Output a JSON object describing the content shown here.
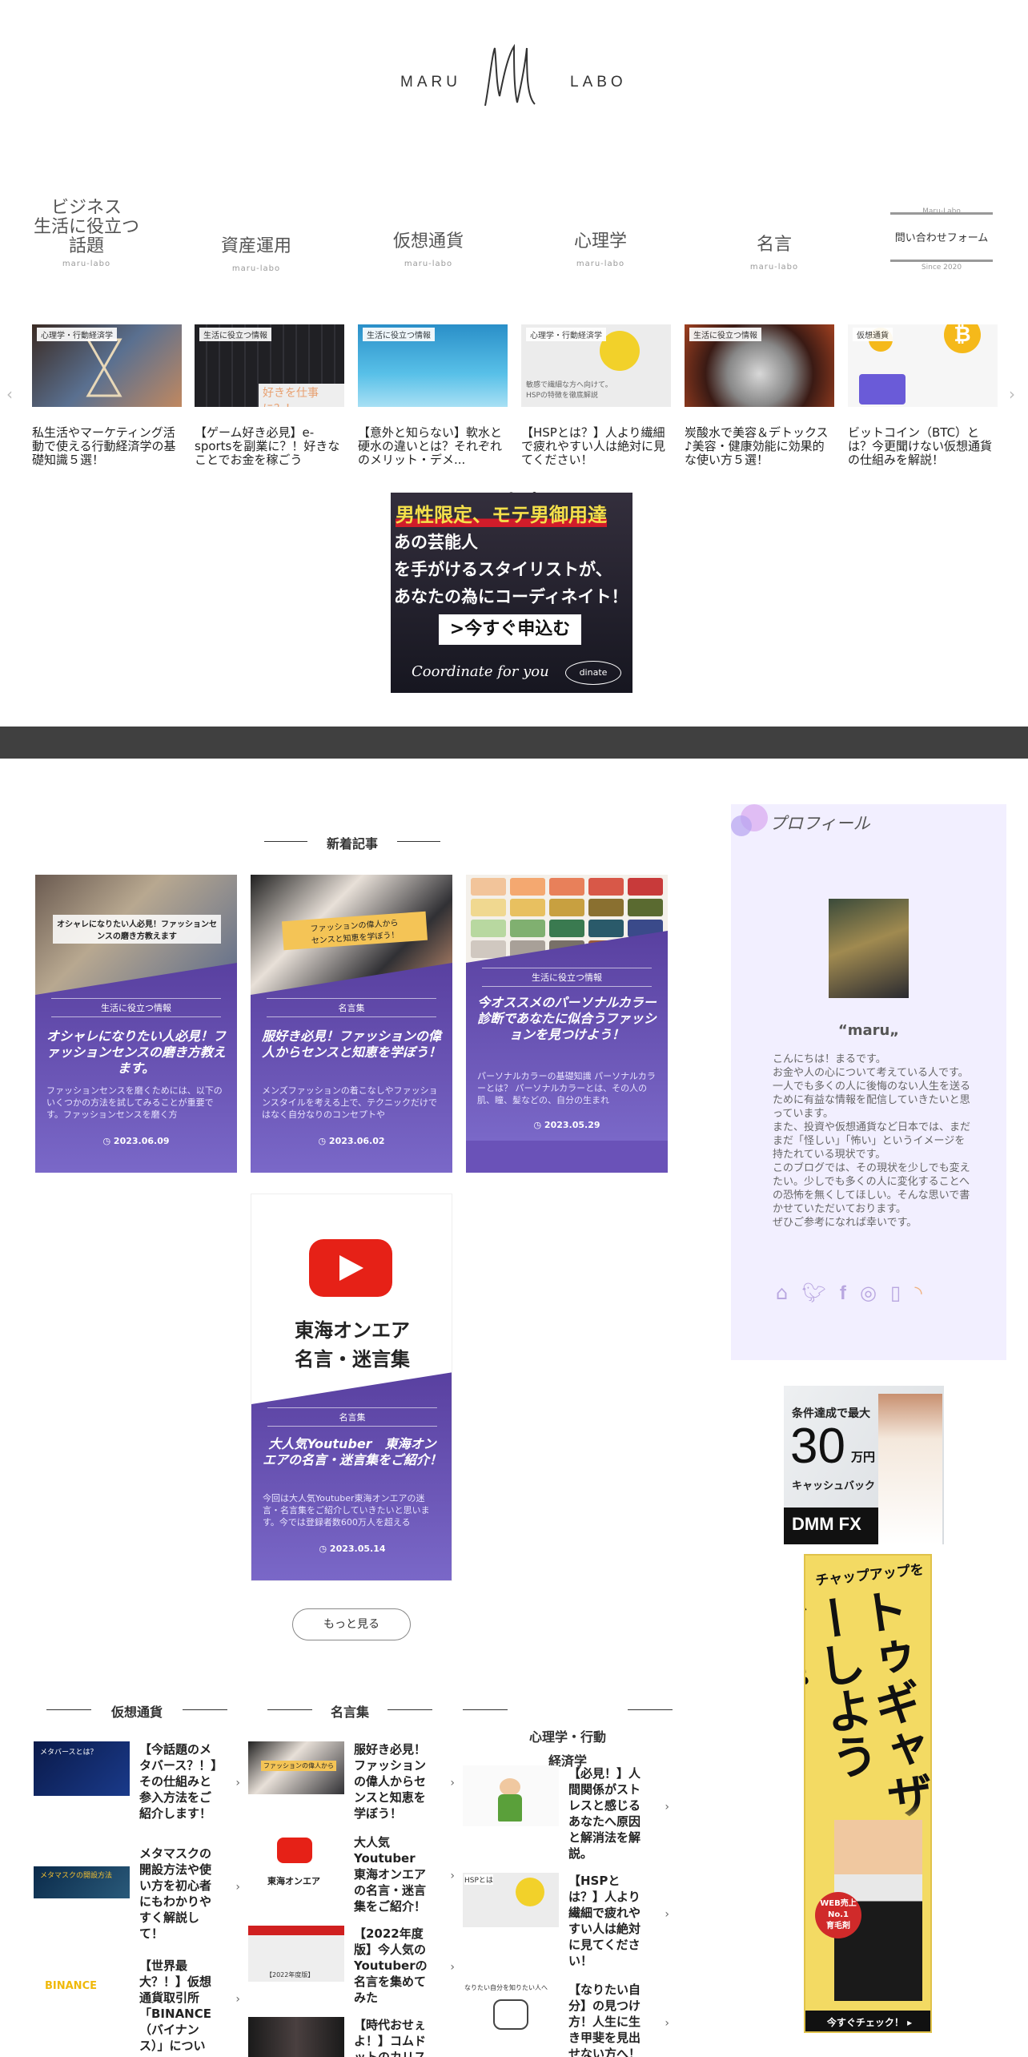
{
  "header": {
    "logo_left": "MARU",
    "logo_right": "LABO",
    "logo_mark": "Ml"
  },
  "nav": {
    "items": [
      {
        "label": "ビジネス\n生活に役立つ\n話題",
        "sub": "maru-labo"
      },
      {
        "label": "資産運用",
        "sub": "maru-labo"
      },
      {
        "label": "仮想通貨",
        "sub": "maru-labo"
      },
      {
        "label": "心理学",
        "sub": "maru-labo"
      },
      {
        "label": "名言",
        "sub": "maru-labo"
      }
    ],
    "contact": {
      "top": "Maru-Labo",
      "label": "問い合わせフォーム",
      "bottom": "Since 2020"
    }
  },
  "carousel": {
    "prev_icon": "chevron-left-icon",
    "next_icon": "chevron-right-icon",
    "slides": [
      {
        "cat": "心理学・行動経済学",
        "title": "私生活やマーケティング活動で使える行動経済学の基礎知識５選！"
      },
      {
        "cat": "生活に役立つ情報",
        "title": "【ゲーム好き必見】e-sportsを副業に？！好きなことでお金を稼ごう",
        "overlay": "好きを仕事に？！"
      },
      {
        "cat": "生活に役立つ情報",
        "title": "【意外と知らない】軟水と硬水の違いとは？それぞれのメリット・デメ..."
      },
      {
        "cat": "心理学・行動経済学",
        "title": "【HSPとは？】人より繊細で疲れやすい人は絶対に見てください！",
        "overlay": "敏感で繊細な方へ向けて。HSPの特徴を徹底解説"
      },
      {
        "cat": "生活に役立つ情報",
        "title": "炭酸水で美容＆デトックス♪美容・健康効能に効果的な使い方５選！"
      },
      {
        "cat": "仮想通貨",
        "title": "ビットコイン（BTC）とは？今更聞けない仮想通貨の仕組みを解説！"
      }
    ]
  },
  "ad_banner": {
    "line1": "男性限定、モテ男御用達",
    "line2": "あの芸能人",
    "line3": "を手がけるスタイリストが、",
    "line4": "あなたの為にコーディネイト！",
    "button": ">今すぐ申込む",
    "signature": "Coordinate for you",
    "brand": "dinate"
  },
  "latest": {
    "heading": "新着記事",
    "cards": [
      {
        "img_text": "オシャレになりたい人必見！ファッションセンスの磨き方教えます",
        "cat": "生活に役立つ情報",
        "title": "オシャレになりたい人必見！ファッションセンスの磨き方教えます。",
        "excerpt": "ファッションセンスを磨くためには、以下のいくつかの方法を試してみることが重要です。ファッションセンスを磨く方",
        "date": "2023.06.09"
      },
      {
        "img_text": "ファッションの偉人から\nセンスと知恵を学ぼう！",
        "cat": "名言集",
        "title": "服好き必見！ファッションの偉人からセンスと知恵を学ぼう！",
        "excerpt": "メンズファッションの着こなしやファッションスタイルを考える上で、テクニックだけではなく自分なりのコンセプトや",
        "date": "2023.06.02"
      },
      {
        "img_text": "",
        "cat": "生活に役立つ情報",
        "title": "今オススメのパーソナルカラー診断であなたに似合うファッションを見つけよう！",
        "excerpt": "パーソナルカラーの基礎知識 パーソナルカラーとは？ パーソナルカラーとは、その人の肌、瞳、髪などの、自分の生まれ",
        "date": "2023.05.29"
      },
      {
        "img_text": "東海オンエア\n名言・迷言集",
        "cat": "名言集",
        "title": "大人気Youtuber　東海オンエアの名言・迷言集をご紹介！",
        "excerpt": "今回は大人気Youtuber東海オンエアの迷言・名言集をご紹介していきたいと思います。今では登録者数600万人を超える",
        "date": "2023.05.14"
      }
    ],
    "more": "もっと見る"
  },
  "columns": [
    {
      "heading": "仮想通貨",
      "items": [
        {
          "thumb": "メタバースとは？",
          "title": "【今話題のメタバース？！】その仕組みと参入方法をご紹介します！"
        },
        {
          "thumb": "メタマスクの開設方法",
          "title": "メタマスクの開設方法や使い方を初心者にもわかりやすく解説し て！"
        },
        {
          "thumb": "BINANCE",
          "title": "【世界最大？！】仮想通貨取引所「BINANCE（バイナンス）」につい"
        }
      ]
    },
    {
      "heading": "名言集",
      "items": [
        {
          "thumb": "ファッションの偉人から",
          "title": "服好き必見！ファッションの偉人からセンスと知恵を学ぼう！"
        },
        {
          "thumb": "東海オンエア",
          "title": "大人気Youtuber　東海オンエアの名言・迷言集をご紹介！"
        },
        {
          "thumb": "【2022年度版】",
          "title": "【2022年度版】今人気のYoutuberの名言を集めてみた"
        },
        {
          "thumb": "",
          "title": "【時代おせぇよ！】コムドットのカリス"
        }
      ]
    },
    {
      "heading": "心理学・行動\n経済学",
      "items": [
        {
          "thumb": "",
          "title": "【必見！】人間関係がストレスと感じるあなたへ原因と解消法を解説。"
        },
        {
          "thumb": "HSPとは",
          "title": "【HSPとは？】人より繊細で疲れやすい人は絶対に見てください！"
        },
        {
          "thumb": "なりたい自分を知りたい人へ",
          "title": "【なりたい自分】の見つけ方！人生に生き甲斐を見出せない方へ！"
        }
      ]
    }
  ],
  "profile": {
    "heading": "プロフィール",
    "name": "maru",
    "bio": "こんにちは！まるです。\nお金や人の心について考えている人です。\n一人でも多くの人に後悔のない人生を送るために有益な情報を配信していきたいと思っています。\nまた、投資や仮想通貨など日本では、まだまだ「怪しい」「怖い」というイメージを持たれている現状です。\nこのブログでは、その現状を少しでも変えたい。少しでも多くの人に変化することへの恐怖を無くしてほしい。そんな思いで書かせていただいております。\nぜひご参考になれば幸いです。",
    "icons": [
      "home-icon",
      "twitter-icon",
      "facebook-icon",
      "instagram-icon",
      "bookmark-icon",
      "rss-icon"
    ]
  },
  "ad_dmm": {
    "line1": "条件達成で最大",
    "amount": "30",
    "unit": "万円",
    "line2": "キャッシュバック",
    "brand": "DMM FX"
  },
  "ad_chapup": {
    "top": "チャップアップを",
    "main": "トゥギャザーしようぜ！",
    "badge": "WEB売上\nNo.1\n育毛剤",
    "cta": "今すぐチェック！"
  },
  "colors": {
    "accent": "#6a52b8",
    "profile_bg": "#f2efff",
    "dark_bar": "#404040"
  }
}
